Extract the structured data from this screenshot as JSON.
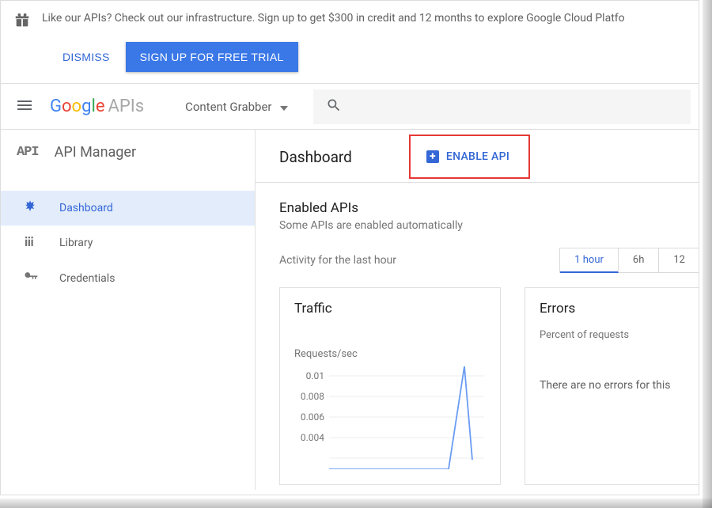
{
  "promo": {
    "text": "Like our APIs? Check out our infrastructure. Sign up to get $300 in credit and 12 months to explore Google Cloud Platfo",
    "dismiss": "DISMISS",
    "signup": "SIGN UP FOR FREE TRIAL"
  },
  "topnav": {
    "logo_suffix": "APIs",
    "project_name": "Content Grabber"
  },
  "sidebar": {
    "title": "API Manager",
    "items": [
      {
        "label": "Dashboard",
        "icon": "dashboard-icon",
        "active": true
      },
      {
        "label": "Library",
        "icon": "library-icon",
        "active": false
      },
      {
        "label": "Credentials",
        "icon": "key-icon",
        "active": false
      }
    ]
  },
  "content": {
    "page_title": "Dashboard",
    "enable_api_btn": "ENABLE API",
    "enabled_apis_title": "Enabled APIs",
    "enabled_apis_sub": "Some APIs are enabled automatically",
    "activity_label": "Activity for the last hour",
    "time_tabs": [
      "1 hour",
      "6h",
      "12"
    ],
    "active_time_tab": 0,
    "traffic": {
      "title": "Traffic",
      "ylabel": "Requests/sec"
    },
    "errors": {
      "title": "Errors",
      "ylabel": "Percent of requests",
      "empty_msg": "There are no errors for this"
    }
  },
  "chart_data": {
    "type": "line",
    "title": "Traffic",
    "ylabel": "Requests/sec",
    "xlabel": "",
    "ylim": [
      0,
      0.01
    ],
    "yticks": [
      0.01,
      0.008,
      0.006,
      0.004
    ],
    "series": [
      {
        "name": "Requests/sec",
        "values": [
          0,
          0,
          0,
          0,
          0,
          0,
          0,
          0,
          0.01,
          0.001
        ]
      }
    ]
  }
}
